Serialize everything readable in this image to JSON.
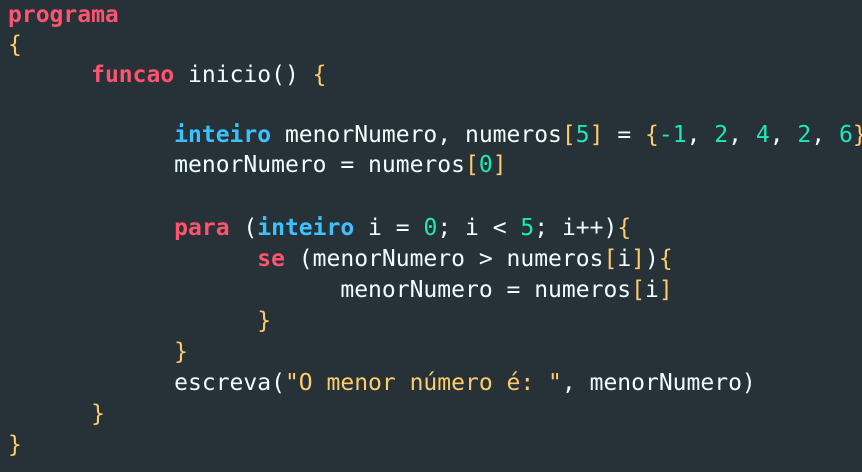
{
  "editor": {
    "lines": [
      {
        "indent": "",
        "tokens": [
          {
            "t": "programa",
            "c": "kw-red"
          }
        ]
      },
      {
        "indent": "",
        "tokens": [
          {
            "t": "{",
            "c": "brace"
          }
        ]
      },
      {
        "indent": "      ",
        "tokens": [
          {
            "t": "funcao",
            "c": "kw-red"
          },
          {
            "t": " inicio() ",
            "c": "plain"
          },
          {
            "t": "{",
            "c": "brace"
          }
        ]
      },
      {
        "indent": "",
        "tokens": []
      },
      {
        "indent": "            ",
        "tokens": [
          {
            "t": "inteiro",
            "c": "kw-blue"
          },
          {
            "t": " menorNumero, numeros",
            "c": "plain"
          },
          {
            "t": "[",
            "c": "bracket"
          },
          {
            "t": "5",
            "c": "num"
          },
          {
            "t": "]",
            "c": "bracket"
          },
          {
            "t": " = ",
            "c": "plain"
          },
          {
            "t": "{",
            "c": "brace"
          },
          {
            "t": "-1",
            "c": "num"
          },
          {
            "t": ", ",
            "c": "plain"
          },
          {
            "t": "2",
            "c": "num"
          },
          {
            "t": ", ",
            "c": "plain"
          },
          {
            "t": "4",
            "c": "num"
          },
          {
            "t": ", ",
            "c": "plain"
          },
          {
            "t": "2",
            "c": "num"
          },
          {
            "t": ", ",
            "c": "plain"
          },
          {
            "t": "6",
            "c": "num"
          },
          {
            "t": "}",
            "c": "brace"
          }
        ]
      },
      {
        "indent": "            ",
        "tokens": [
          {
            "t": "menorNumero = numeros",
            "c": "plain"
          },
          {
            "t": "[",
            "c": "bracket"
          },
          {
            "t": "0",
            "c": "num"
          },
          {
            "t": "]",
            "c": "bracket"
          }
        ]
      },
      {
        "indent": "",
        "tokens": []
      },
      {
        "indent": "            ",
        "tokens": [
          {
            "t": "para",
            "c": "kw-red"
          },
          {
            "t": " (",
            "c": "plain"
          },
          {
            "t": "inteiro",
            "c": "kw-blue"
          },
          {
            "t": " i = ",
            "c": "plain"
          },
          {
            "t": "0",
            "c": "num"
          },
          {
            "t": "; i < ",
            "c": "plain"
          },
          {
            "t": "5",
            "c": "num"
          },
          {
            "t": "; i++)",
            "c": "plain"
          },
          {
            "t": "{",
            "c": "brace"
          }
        ]
      },
      {
        "indent": "                  ",
        "tokens": [
          {
            "t": "se",
            "c": "kw-red"
          },
          {
            "t": " (menorNumero > numeros",
            "c": "plain"
          },
          {
            "t": "[",
            "c": "bracket"
          },
          {
            "t": "i",
            "c": "plain"
          },
          {
            "t": "]",
            "c": "bracket"
          },
          {
            "t": ")",
            "c": "plain"
          },
          {
            "t": "{",
            "c": "brace"
          }
        ]
      },
      {
        "indent": "                        ",
        "tokens": [
          {
            "t": "menorNumero = numeros",
            "c": "plain"
          },
          {
            "t": "[",
            "c": "bracket"
          },
          {
            "t": "i",
            "c": "plain"
          },
          {
            "t": "]",
            "c": "bracket"
          }
        ]
      },
      {
        "indent": "                  ",
        "tokens": [
          {
            "t": "}",
            "c": "brace"
          }
        ]
      },
      {
        "indent": "            ",
        "tokens": [
          {
            "t": "}",
            "c": "brace"
          }
        ]
      },
      {
        "indent": "            ",
        "tokens": [
          {
            "t": "escreva(",
            "c": "plain"
          },
          {
            "t": "\"O menor número é: \"",
            "c": "str"
          },
          {
            "t": ", menorNumero)",
            "c": "plain"
          }
        ]
      },
      {
        "indent": "      ",
        "tokens": [
          {
            "t": "}",
            "c": "brace"
          }
        ]
      },
      {
        "indent": "",
        "tokens": [
          {
            "t": "}",
            "c": "brace"
          }
        ]
      }
    ]
  },
  "colors": {
    "background": "#263238",
    "keyword_red": "#ff5370",
    "keyword_blue": "#3ec1ff",
    "brace": "#ffcb6b",
    "number": "#1de9b6",
    "string": "#ffcb6b",
    "text": "#eeffff"
  }
}
